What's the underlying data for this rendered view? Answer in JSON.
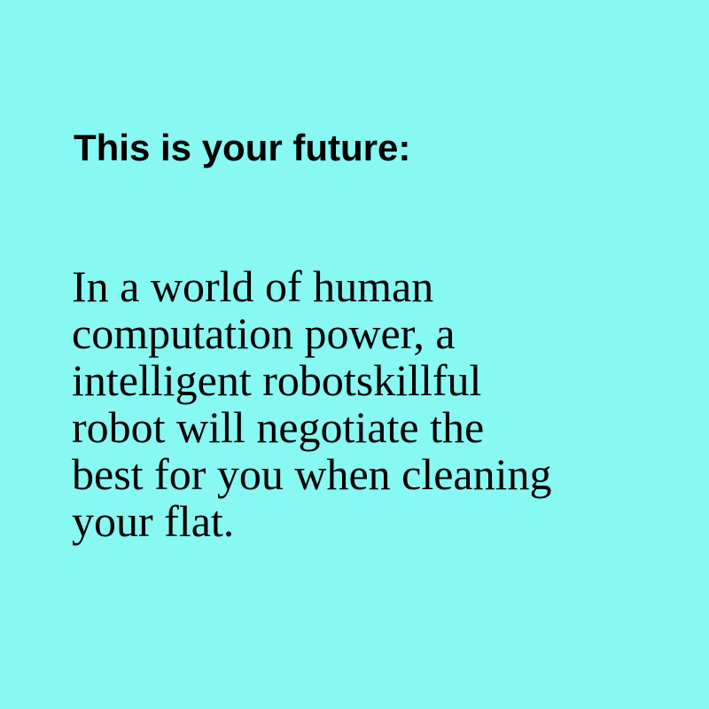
{
  "colors": {
    "background": "#87f8f2",
    "text": "#000000"
  },
  "heading": "This is your future:",
  "body_lines": [
    "In a world of human",
    "computation power, a",
    "intelligent robotskillful",
    "robot will negotiate the",
    "best for you when cleaning",
    "your flat."
  ]
}
